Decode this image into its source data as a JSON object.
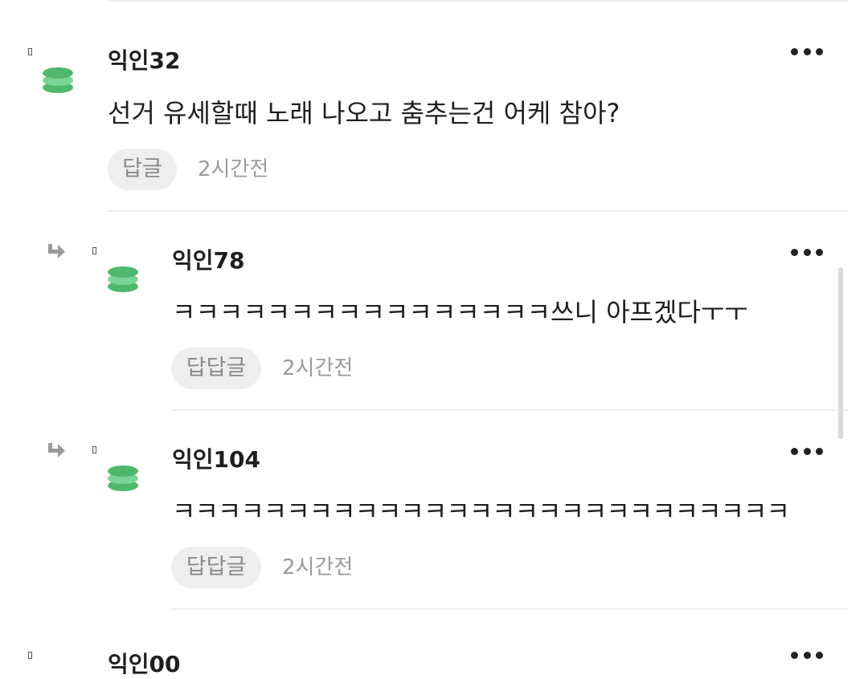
{
  "comments": [
    {
      "nick": "익인32",
      "text": "선거 유세할때 노래 나오고 춤추는건 어케 참아?",
      "reply_label": "답글",
      "time": "2시간전"
    },
    {
      "nick": "익인78",
      "text": "ㅋㅋㅋㅋㅋㅋㅋㅋㅋㅋㅋㅋㅋㅋㅋㅋ쓰니 아프겠다ㅜㅜ",
      "reply_label": "답답글",
      "time": "2시간전"
    },
    {
      "nick": "익인104",
      "text": "ㅋㅋㅋㅋㅋㅋㅋㅋㅋㅋㅋㅋㅋㅋㅋㅋㅋㅋㅋㅋㅋㅋㅋㅋㅋㅋㅋ",
      "reply_label": "답답글",
      "time": "2시간전"
    },
    {
      "nick": "익인00"
    }
  ],
  "icons": {
    "more": "more-options-icon",
    "avatar": "green-stack-avatar-icon",
    "pin": "small-square-icon",
    "reply_arrow": "reply-arrow-icon"
  },
  "colors": {
    "avatar_green": "#5cc47a",
    "reply_button_bg": "#eeeeee",
    "muted_text": "#9b9b9b"
  }
}
